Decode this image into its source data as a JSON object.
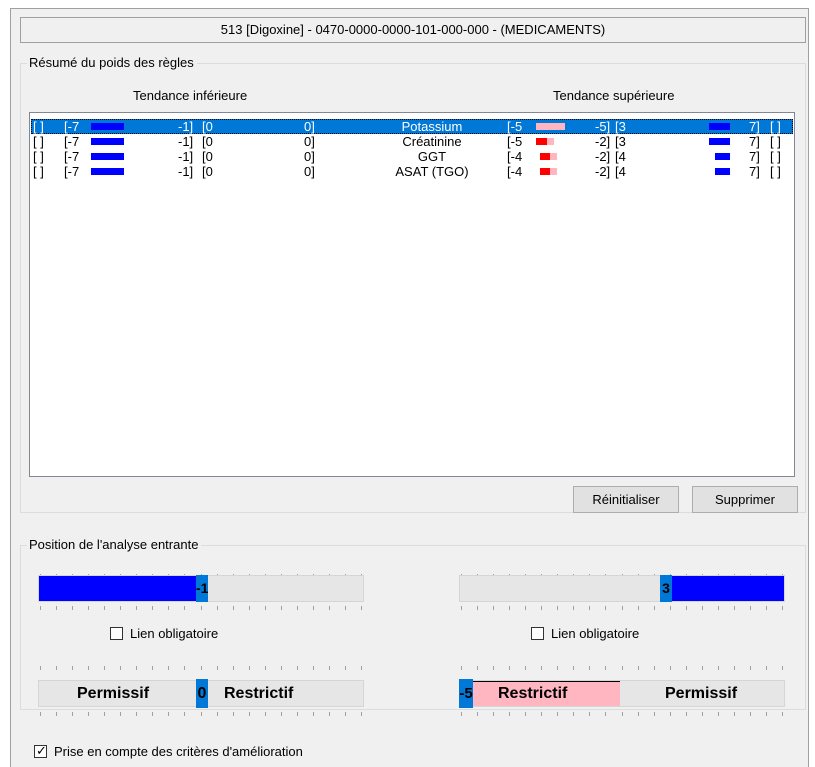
{
  "window": {
    "title": "513 [Digoxine] - 0470-0000-0000-101-000-000 - (MEDICAMENTS)"
  },
  "summary": {
    "legend": "Résumé du poids des règles",
    "col_lower": "Tendance inférieure",
    "col_upper": "Tendance supérieure",
    "rows": [
      {
        "flag_l": "[ ]",
        "lmin": "[-7",
        "lmax": "-1]",
        "lzero": "[0",
        "lzero_end": "0]",
        "name": "Potassium",
        "umin": "[-5",
        "umin_end": "-5]",
        "umax": "[3",
        "umax_end": "7]",
        "flag_r": "[ ]",
        "selected": true
      },
      {
        "flag_l": "[ ]",
        "lmin": "[-7",
        "lmax": "-1]",
        "lzero": "[0",
        "lzero_end": "0]",
        "name": "Créatinine",
        "umin": "[-5",
        "umin_end": "-2]",
        "umax": "[3",
        "umax_end": "7]",
        "flag_r": "[ ]",
        "selected": false
      },
      {
        "flag_l": "[ ]",
        "lmin": "[-7",
        "lmax": "-1]",
        "lzero": "[0",
        "lzero_end": "0]",
        "name": "GGT",
        "umin": "[-4",
        "umin_end": "-2]",
        "umax": "[4",
        "umax_end": "7]",
        "flag_r": "[ ]",
        "selected": false
      },
      {
        "flag_l": "[ ]",
        "lmin": "[-7",
        "lmax": "-1]",
        "lzero": "[0",
        "lzero_end": "0]",
        "name": "ASAT (TGO)",
        "umin": "[-4",
        "umin_end": "-2]",
        "umax": "[4",
        "umax_end": "7]",
        "flag_r": "[ ]",
        "selected": false
      }
    ],
    "reset_label": "Réinitialiser",
    "delete_label": "Supprimer"
  },
  "position": {
    "legend": "Position de l'analyse entrante",
    "lower_slider_value": "-1",
    "upper_slider_value": "3",
    "lower_link_label": "Lien obligatoire",
    "upper_link_label": "Lien obligatoire",
    "lower_link_checked": false,
    "upper_link_checked": false,
    "lower_mode_value": "0",
    "lower_mode_left": "Permissif",
    "lower_mode_right": "Restrictif",
    "upper_mode_value": "-5",
    "upper_mode_left": "Restrictif",
    "upper_mode_right": "Permissif"
  },
  "improvement": {
    "label": "Prise en compte des critères d'amélioration",
    "checked": true,
    "check_glyph": "✓"
  },
  "colors": {
    "accent": "#0078d7",
    "blue_bar": "#0000ff",
    "red_bar": "#ff0000",
    "pink_bar": "#ffb6c1"
  }
}
